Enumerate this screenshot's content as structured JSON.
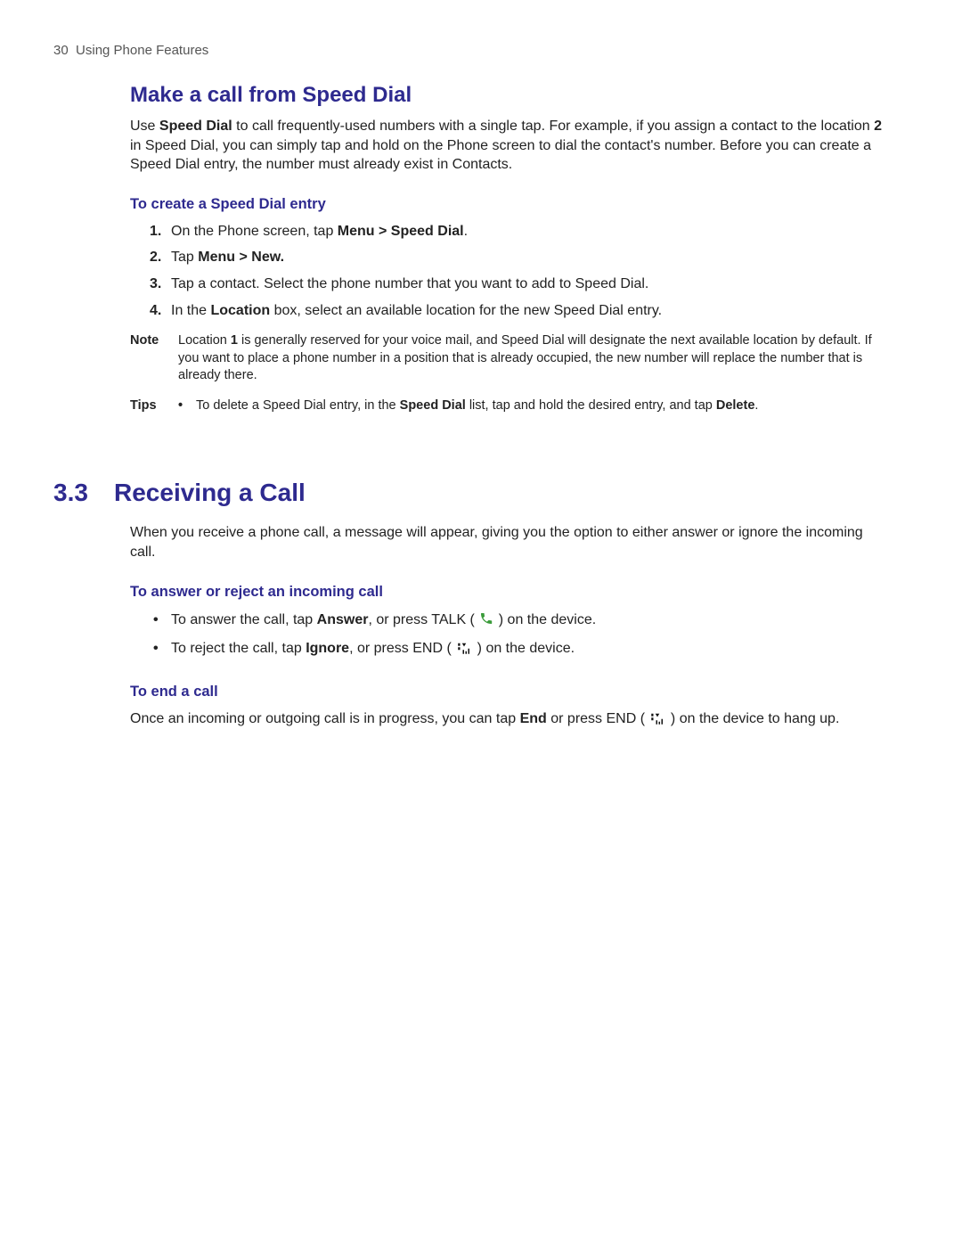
{
  "header": {
    "page_number": "30",
    "chapter": "Using Phone Features"
  },
  "sections": {
    "speed_dial": {
      "title": "Make a call from Speed Dial",
      "intro_pre": "Use ",
      "intro_bold1": "Speed Dial",
      "intro_mid1": " to call frequently-used numbers with a single tap. For example, if you assign a contact to the location ",
      "intro_bold2": "2",
      "intro_mid2": " in Speed Dial, you can simply tap and hold ",
      "intro_post": " on the Phone screen to dial the contact's number. Before you can create a Speed Dial entry, the number must already exist in Contacts.",
      "create": {
        "heading": "To create a Speed Dial entry",
        "steps": [
          {
            "num": "1.",
            "pre": "On the Phone screen, tap ",
            "bold": "Menu > Speed Dial",
            "post": "."
          },
          {
            "num": "2.",
            "pre": "Tap ",
            "bold": "Menu > New.",
            "post": ""
          },
          {
            "num": "3.",
            "pre": "Tap a contact. Select the phone number that you want to add to Speed Dial.",
            "bold": "",
            "post": ""
          },
          {
            "num": "4.",
            "pre": "In the ",
            "bold": "Location",
            "post": " box, select an available location for the new Speed Dial entry."
          }
        ]
      },
      "note": {
        "label": "Note",
        "pre": "Location ",
        "bold": "1",
        "post": " is generally reserved for your voice mail, and Speed Dial will designate the next available location by default. If you want to place a phone number in a position that is already occupied, the new number will replace the number that is already there."
      },
      "tips": {
        "label": "Tips",
        "pre": "To delete a Speed Dial entry, in the ",
        "bold1": "Speed Dial",
        "mid": " list, tap and hold the desired entry, and tap ",
        "bold2": "Delete",
        "post": "."
      }
    },
    "receiving": {
      "number": "3.3",
      "title": "Receiving a Call",
      "intro": "When you receive a phone call, a message will appear, giving you the option to either answer or ignore the incoming call.",
      "answer": {
        "heading": "To answer or reject an incoming call",
        "item1_pre": "To answer the call, tap ",
        "item1_bold": "Answer",
        "item1_mid": ", or press TALK ( ",
        "item1_post": " ) on the device.",
        "item2_pre": "To reject the call, tap ",
        "item2_bold": "Ignore",
        "item2_mid": ", or press END ( ",
        "item2_post": " ) on the device."
      },
      "end": {
        "heading": "To end a call",
        "pre": "Once an incoming or outgoing call is in progress, you can tap ",
        "bold": "End",
        "mid": " or press END ( ",
        "post": " ) on the device to hang up."
      }
    }
  },
  "icons": {
    "talk": "phone-talk-icon",
    "end": "phone-end-icon"
  }
}
